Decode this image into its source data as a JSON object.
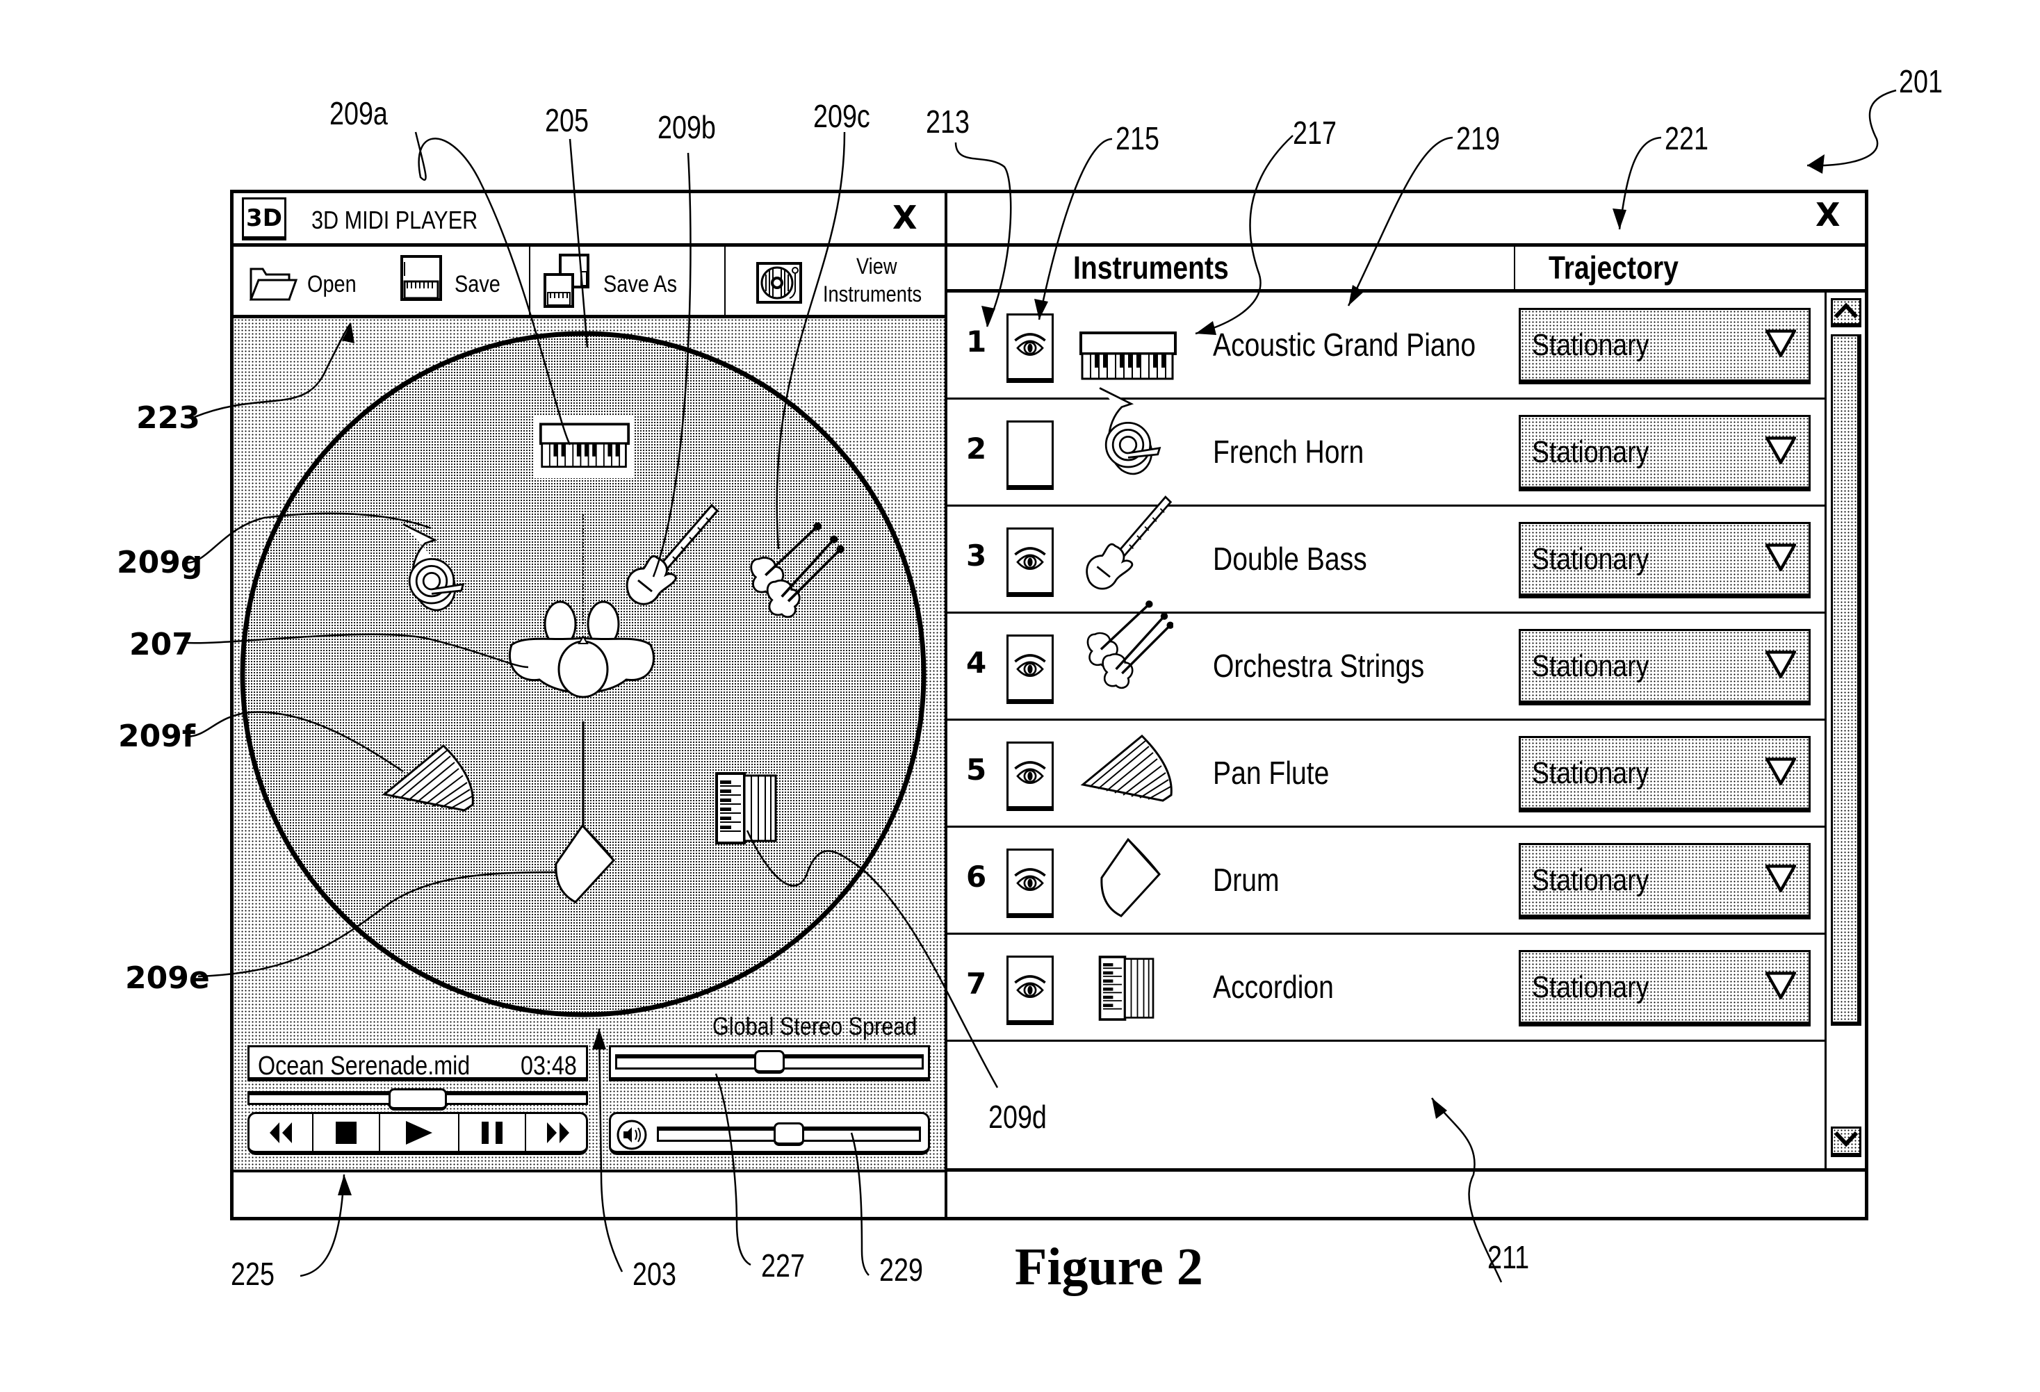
{
  "player": {
    "app_icon": "3D",
    "title": "3D MIDI PLAYER",
    "close_label": "X",
    "toolbar": {
      "open_label": "Open",
      "save_label": "Save",
      "save_as_label": "Save As",
      "view_instruments_label_line1": "View",
      "view_instruments_label_line2": "Instruments"
    },
    "stage": {
      "instruments": [
        {
          "id": "209a",
          "name": "Acoustic Grand Piano",
          "icon": "piano-icon"
        },
        {
          "id": "209b",
          "name": "Double Bass",
          "icon": "bass-guitar-icon"
        },
        {
          "id": "209c",
          "name": "Orchestra Strings",
          "icon": "violins-icon"
        },
        {
          "id": "209d",
          "name": "Accordion",
          "icon": "accordion-icon"
        },
        {
          "id": "209e",
          "name": "Drum",
          "icon": "drum-icon"
        },
        {
          "id": "209f",
          "name": "Pan Flute",
          "icon": "pan-flute-icon"
        },
        {
          "id": "209g",
          "name": "French Horn",
          "icon": "french-horn-icon"
        }
      ],
      "listener_icon": "listener-head-icon"
    },
    "transport": {
      "filename": "Ocean Serenade.mid",
      "time": "03:48",
      "progress_fraction": 0.5,
      "buttons": [
        {
          "name": "rewind",
          "icon": "rewind-icon",
          "glyph": "◀◀"
        },
        {
          "name": "stop",
          "icon": "stop-icon",
          "glyph": "■"
        },
        {
          "name": "play",
          "icon": "play-icon",
          "glyph": "▶"
        },
        {
          "name": "pause",
          "icon": "pause-icon",
          "glyph": "❚❚"
        },
        {
          "name": "fast-forward",
          "icon": "fast-forward-icon",
          "glyph": "▶▶"
        }
      ]
    },
    "stereo": {
      "label": "Global Stereo Spread",
      "spread_fraction": 0.5,
      "volume_fraction": 0.5
    }
  },
  "instrument_panel": {
    "close_label": "X",
    "headers": {
      "instruments": "Instruments",
      "trajectory": "Trajectory"
    },
    "rows": [
      {
        "number": "1",
        "visible": true,
        "name": "Acoustic Grand Piano",
        "icon": "piano-icon",
        "trajectory": "Stationary"
      },
      {
        "number": "2",
        "visible": false,
        "name": "French Horn",
        "icon": "french-horn-icon",
        "trajectory": "Stationary"
      },
      {
        "number": "3",
        "visible": true,
        "name": "Double Bass",
        "icon": "bass-guitar-icon",
        "trajectory": "Stationary"
      },
      {
        "number": "4",
        "visible": true,
        "name": "Orchestra Strings",
        "icon": "violins-icon",
        "trajectory": "Stationary"
      },
      {
        "number": "5",
        "visible": true,
        "name": "Pan Flute",
        "icon": "pan-flute-icon",
        "trajectory": "Stationary"
      },
      {
        "number": "6",
        "visible": true,
        "name": "Drum",
        "icon": "drum-icon",
        "trajectory": "Stationary"
      },
      {
        "number": "7",
        "visible": true,
        "name": "Accordion",
        "icon": "accordion-icon",
        "trajectory": "Stationary"
      }
    ]
  },
  "figure": {
    "caption": "Figure 2",
    "refs": {
      "r201": "201",
      "r203": "203",
      "r205": "205",
      "r207": "207",
      "r209a": "209a",
      "r209b": "209b",
      "r209c": "209c",
      "r209d": "209d",
      "r209e": "209e",
      "r209f": "209f",
      "r209g": "209g",
      "r211": "211",
      "r213": "213",
      "r215": "215",
      "r217": "217",
      "r219": "219",
      "r221": "221",
      "r223": "223",
      "r225": "225",
      "r227": "227",
      "r229": "229"
    }
  }
}
